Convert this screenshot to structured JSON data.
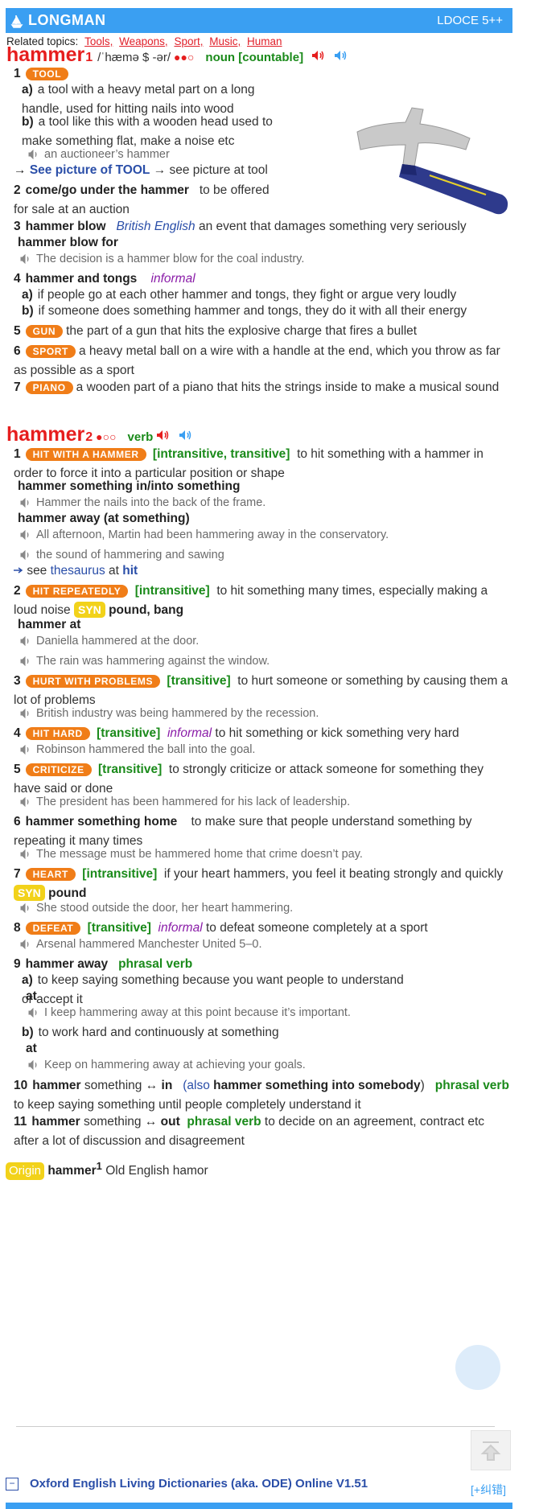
{
  "header": {
    "logo": "LONGMAN",
    "version": "LDOCE 5++"
  },
  "related": {
    "label": "Related topics:",
    "topics": [
      "Tools,",
      "Weapons,",
      "Sport,",
      "Music,",
      "Human"
    ]
  },
  "entry1": {
    "word": "hammer",
    "homnum": "1",
    "pron": "/ˈhæmə $ -ər/",
    "freq": "●●○",
    "pos": "noun",
    "gram": "[countable]",
    "s1": {
      "num": "1",
      "badge": "TOOL",
      "a_label": "a)",
      "a_text": "a tool with a heavy metal part on a long handle, used for hitting nails into wood",
      "b_label": "b)",
      "b_text": "a tool like this with a wooden head used to make something flat, make a noise etc",
      "b_ex": "an auctioneer’s hammer",
      "see1": "See picture of TOOL",
      "see2": "→ see picture at",
      "see2b": "tool",
      "arrow": "→"
    },
    "s2": {
      "num": "2",
      "phrase": "come/go under the hammer",
      "def": "to be offered for sale at an auction"
    },
    "s3": {
      "num": "3",
      "phrase": "hammer blow",
      "region": "British English",
      "def": "an event that damages something very seriously",
      "sub": "hammer blow for",
      "ex": "The decision is a hammer blow for the coal industry."
    },
    "s4": {
      "num": "4",
      "phrase": "hammer and tongs",
      "reg": "informal",
      "a_label": "a)",
      "a_text": "if people go at each other hammer and tongs, they fight or argue very loudly",
      "b_label": "b)",
      "b_text": "if someone does something hammer and tongs, they do it with all their energy"
    },
    "s5": {
      "num": "5",
      "badge": "GUN",
      "def": "the part of a gun that hits the explosive charge that fires a bullet"
    },
    "s6": {
      "num": "6",
      "badge": "SPORT",
      "def": "a heavy metal ball on a wire with a handle at the end, which you throw as far as possible as a sport"
    },
    "s7": {
      "num": "7",
      "badge": "PIANO",
      "def": "a wooden part of a piano that hits the strings inside to make a musical sound"
    }
  },
  "entry2": {
    "word": "hammer",
    "homnum": "2",
    "freq": "●○○",
    "pos": "verb",
    "s1": {
      "num": "1",
      "badge": "HIT WITH A HAMMER",
      "gram": "[intransitive, transitive]",
      "def": "to hit something with a hammer in order to force it into a particular position or shape",
      "sub1": "hammer something in/into something",
      "ex1": "Hammer the nails into the back of the frame.",
      "sub2": "hammer away (at something)",
      "ex2": "All afternoon, Martin had been hammering away in the conservatory.",
      "ex3": "the sound of hammering and sawing",
      "see": "see",
      "thes": "thesaurus",
      "at": "at",
      "hit": "hit"
    },
    "s2": {
      "num": "2",
      "badge": "HIT REPEATEDLY",
      "gram": "[intransitive]",
      "def": "to hit something many times, especially making a loud noise",
      "syn": "SYN",
      "synw": "pound, bang",
      "sub": "hammer at",
      "ex1": "Daniella hammered at the door.",
      "ex2": "The rain was hammering against the window."
    },
    "s3": {
      "num": "3",
      "badge": "HURT WITH PROBLEMS",
      "gram": "[transitive]",
      "def": "to hurt someone or something by causing them a lot of problems",
      "ex": "British industry was being hammered by the recession."
    },
    "s4": {
      "num": "4",
      "badge": "HIT HARD",
      "gram": "[transitive]",
      "reg": "informal",
      "def": "to hit something or kick something very hard",
      "ex": "Robinson hammered the ball into the goal."
    },
    "s5": {
      "num": "5",
      "badge": "CRITICIZE",
      "gram": "[transitive]",
      "def": "to strongly criticize or attack someone for something they have said or done",
      "ex": "The president has been hammered for his lack of leadership."
    },
    "s6": {
      "num": "6",
      "phrase": "hammer something home",
      "def": "to make sure that people understand something by repeating it many times",
      "ex": "The message must be hammered home that crime doesn’t pay."
    },
    "s7": {
      "num": "7",
      "badge": "HEART",
      "gram": "[intransitive]",
      "def": "if your heart hammers, you feel it beating strongly and quickly",
      "syn": "SYN",
      "synw": "pound",
      "ex": "She stood outside the door, her heart hammering."
    },
    "s8": {
      "num": "8",
      "badge": "DEFEAT",
      "gram": "[transitive]",
      "reg": "informal",
      "def": "to defeat someone completely at a sport",
      "ex": "Arsenal hammered Manchester United 5–0."
    },
    "s9": {
      "num": "9",
      "phrase": "hammer away",
      "pv": "phrasal verb",
      "a_label": "a)",
      "a_text": "to keep saying something because you want people to understand or accept it",
      "a_sub": "at",
      "a_ex": "I keep hammering away at this point because it’s important.",
      "b_label": "b)",
      "b_text": "to work hard and continuously at something",
      "b_sub": "at",
      "b_ex": "Keep on hammering away at achieving your goals."
    },
    "s10": {
      "num": "10",
      "p1": "hammer",
      "p2": "something ↔",
      "p3": "in",
      "also": "(also",
      "alsob": "hammer something into somebody",
      "close": ")",
      "pv": "phrasal verb",
      "def": "to keep saying something until people completely understand it"
    },
    "s11": {
      "num": "11",
      "p1": "hammer",
      "p2": "something ↔",
      "p3": "out",
      "pv": "phrasal verb",
      "def": "to decide on an agreement, contract etc after a lot of discussion and disagreement"
    }
  },
  "origin": {
    "label": "Origin",
    "word": "hammer",
    "homnum": "1",
    "text": "Old English hamor"
  },
  "footer": {
    "minus": "−",
    "title": "Oxford English Living Dictionaries (aka. ODE) Online V1.51",
    "fix": "[+纠错]"
  },
  "colors": {
    "accent": "#3a9ff2",
    "red": "#e61e1e",
    "orange": "#f07d18",
    "green": "#1a8a1a",
    "yellow": "#f2d21a"
  }
}
